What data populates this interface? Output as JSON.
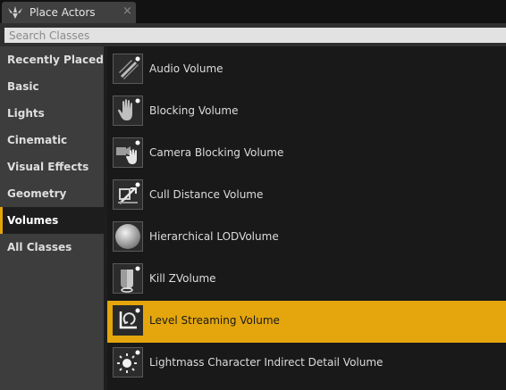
{
  "tab": {
    "title": "Place Actors",
    "close": "×"
  },
  "search": {
    "placeholder": "Search Classes",
    "value": ""
  },
  "accent_color": "#e4a50b",
  "sidebar": {
    "items": [
      {
        "label": "Recently Placed",
        "selected": false
      },
      {
        "label": "Basic",
        "selected": false
      },
      {
        "label": "Lights",
        "selected": false
      },
      {
        "label": "Cinematic",
        "selected": false
      },
      {
        "label": "Visual Effects",
        "selected": false
      },
      {
        "label": "Geometry",
        "selected": false
      },
      {
        "label": "Volumes",
        "selected": true
      },
      {
        "label": "All Classes",
        "selected": false
      }
    ]
  },
  "actors": [
    {
      "label": "Audio Volume",
      "icon": "audio-volume-icon",
      "selected": false
    },
    {
      "label": "Blocking Volume",
      "icon": "hand-icon",
      "selected": false
    },
    {
      "label": "Camera Blocking Volume",
      "icon": "camera-hand-icon",
      "selected": false
    },
    {
      "label": "Cull Distance Volume",
      "icon": "cull-distance-icon",
      "selected": false
    },
    {
      "label": "Hierarchical LODVolume",
      "icon": "sphere-icon",
      "selected": false
    },
    {
      "label": "Kill ZVolume",
      "icon": "kill-z-icon",
      "selected": false
    },
    {
      "label": "Level Streaming Volume",
      "icon": "level-streaming-icon",
      "selected": true
    },
    {
      "label": "Lightmass Character Indirect Detail Volume",
      "icon": "sun-icon",
      "selected": false
    }
  ]
}
